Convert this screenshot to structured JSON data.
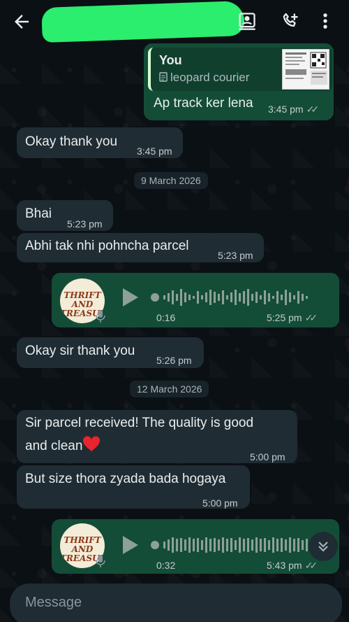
{
  "header": {
    "back_icon": "arrow-left-icon",
    "contact_icon": "contact-card-icon",
    "call_icon": "add-call-icon",
    "menu_icon": "more-vert-icon"
  },
  "reply": {
    "author": "You",
    "doc_name": "leopard courier",
    "text": "Ap track ker lena",
    "time": "3:45 pm"
  },
  "messages": [
    {
      "text": "Okay thank you",
      "time": "3:45 pm"
    },
    {
      "date": "9 March 2026"
    },
    {
      "text": "Bhai",
      "time": "5:23 pm"
    },
    {
      "text": "Abhi tak nhi pohncha parcel",
      "time": "5:23 pm"
    },
    {
      "text": "Okay sir thank you",
      "time": "5:26 pm"
    },
    {
      "date": "12 March 2026"
    },
    {
      "text_line1": "Sir parcel received! The quality is good",
      "text_line2": "and clean",
      "time": "5:00 pm"
    },
    {
      "text": "But size thora zyada bada hogaya",
      "time": "5:00 pm"
    }
  ],
  "voice_notes": [
    {
      "duration": "0:16",
      "time": "5:25 pm",
      "avatar_line1": "THRIFT AND",
      "avatar_line2": "TREASURE"
    },
    {
      "duration": "0:32",
      "time": "5:43 pm",
      "avatar_line1": "THRIFT AND",
      "avatar_line2": "TREASURE"
    }
  ],
  "composer": {
    "placeholder": "Message"
  },
  "colors": {
    "outgoing": "#144d37",
    "incoming": "#1f2c33",
    "background": "#0b1014",
    "redaction": "#2bed6e"
  }
}
